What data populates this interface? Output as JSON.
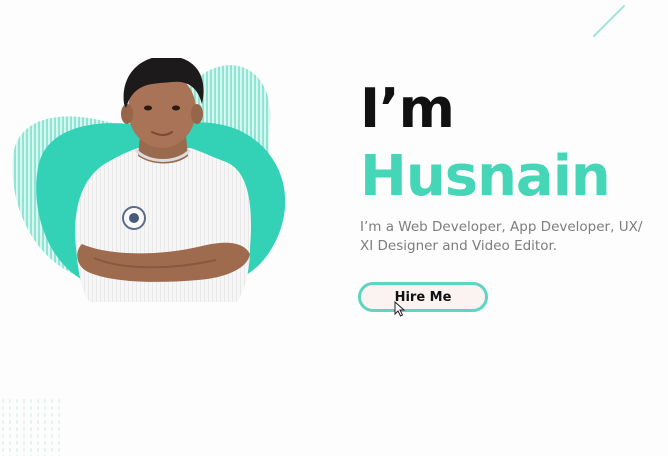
{
  "hero": {
    "greeting": "I’m",
    "name": "Husnain",
    "tagline": "I’m a Web Developer, App Developer, UX/ XI Designer and Video Editor.",
    "hire_button_label": "Hire Me"
  },
  "icons": [
    "profile-photo",
    "mouse-cursor-icon",
    "decorative-line",
    "dot-pattern"
  ],
  "colors": {
    "accent": "#45d6b7",
    "blob": "#33d2b6",
    "heading": "#111111",
    "body_text": "#7d7d7d",
    "button_border": "#5cd6c0",
    "button_bg": "#fbf2f2",
    "background": "#fdfdfd"
  }
}
